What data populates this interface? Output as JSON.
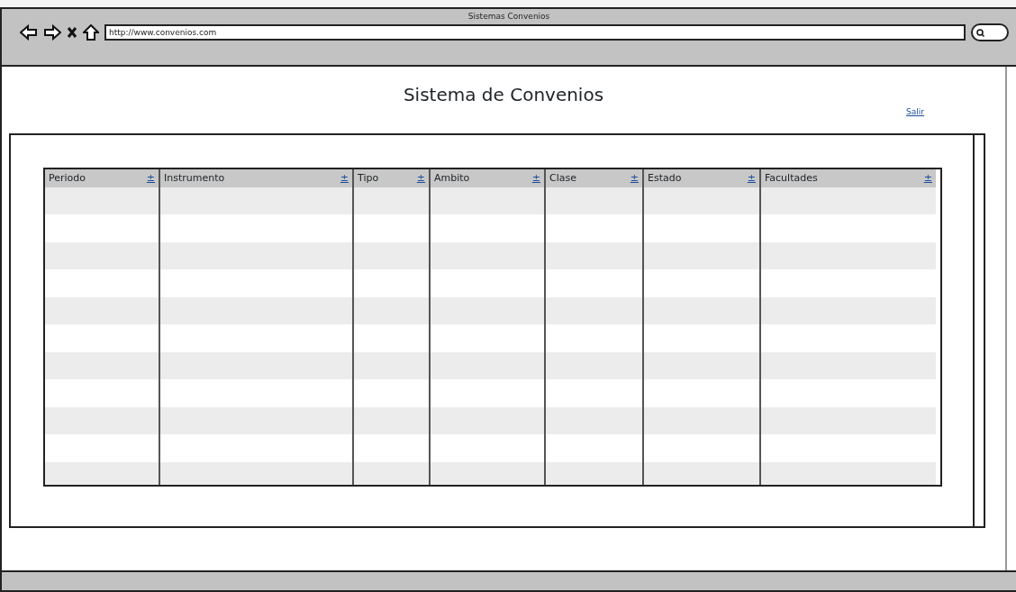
{
  "window": {
    "title": "Sistemas Convenios",
    "url": "http://www.convenios.com"
  },
  "page": {
    "heading": "Sistema de Convenios",
    "logout_link": "Salir"
  },
  "table": {
    "columns": [
      {
        "label": "Periodo",
        "sort": "±"
      },
      {
        "label": "Instrumento",
        "sort": "±"
      },
      {
        "label": "Tipo",
        "sort": "±"
      },
      {
        "label": "Ambito",
        "sort": "±"
      },
      {
        "label": "Clase",
        "sort": "±"
      },
      {
        "label": "Estado",
        "sort": "±"
      },
      {
        "label": "Facultades",
        "sort": "±"
      }
    ]
  }
}
